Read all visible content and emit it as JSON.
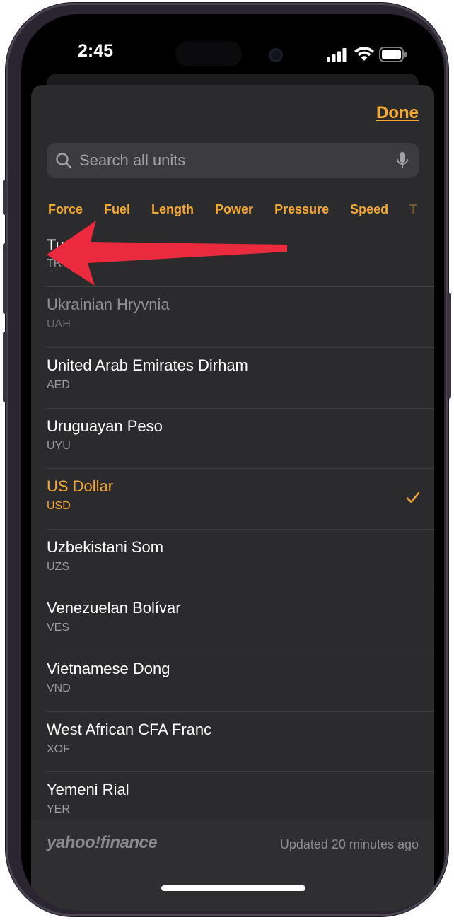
{
  "status_bar": {
    "time": "2:45"
  },
  "header": {
    "done_label": "Done"
  },
  "search": {
    "placeholder": "Search all units"
  },
  "categories": [
    {
      "label": "Force"
    },
    {
      "label": "Fuel"
    },
    {
      "label": "Length"
    },
    {
      "label": "Power"
    },
    {
      "label": "Pressure"
    },
    {
      "label": "Speed"
    },
    {
      "label": "T"
    }
  ],
  "units": [
    {
      "name": "Tu",
      "code": "TRY"
    },
    {
      "name": "Ukrainian Hryvnia",
      "code": "UAH"
    },
    {
      "name": "United Arab Emirates Dirham",
      "code": "AED"
    },
    {
      "name": "Uruguayan Peso",
      "code": "UYU"
    },
    {
      "name": "US Dollar",
      "code": "USD"
    },
    {
      "name": "Uzbekistani Som",
      "code": "UZS"
    },
    {
      "name": "Venezuelan Bolívar",
      "code": "VES"
    },
    {
      "name": "Vietnamese Dong",
      "code": "VND"
    },
    {
      "name": "West African CFA Franc",
      "code": "XOF"
    },
    {
      "name": "Yemeni Rial",
      "code": "YER"
    }
  ],
  "footer": {
    "logo_text": "yahoo!finance",
    "updated": "Updated 20 minutes ago"
  },
  "colors": {
    "accent": "#f7a832",
    "arrow": "#ec2a3e",
    "sheet_bg": "#2b2b2d"
  }
}
